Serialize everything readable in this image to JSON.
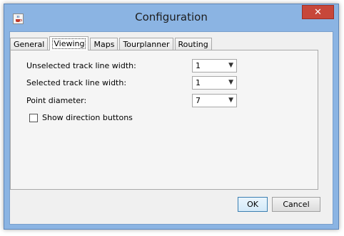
{
  "window": {
    "title": "Configuration",
    "close_glyph": "✕"
  },
  "tabs": [
    {
      "label": "General",
      "active": false
    },
    {
      "label": "Viewing",
      "active": true
    },
    {
      "label": "Maps",
      "active": false
    },
    {
      "label": "Tourplanner",
      "active": false
    },
    {
      "label": "Routing",
      "active": false
    }
  ],
  "viewing": {
    "unselected_track_line_width": {
      "label": "Unselected track line width:",
      "value": "1"
    },
    "selected_track_line_width": {
      "label": "Selected track line width:",
      "value": "1"
    },
    "point_diameter": {
      "label": "Point diameter:",
      "value": "7"
    },
    "show_direction_buttons": {
      "label": "Show direction buttons",
      "checked": false
    }
  },
  "buttons": {
    "ok": "OK",
    "cancel": "Cancel"
  },
  "icons": {
    "app": "java-cup-icon",
    "close": "close-icon",
    "dropdown": "chevron-down-icon"
  },
  "colors": {
    "titlebar": "#8bb4e3",
    "close_button": "#c7473a",
    "panel": "#f0f0f0"
  }
}
